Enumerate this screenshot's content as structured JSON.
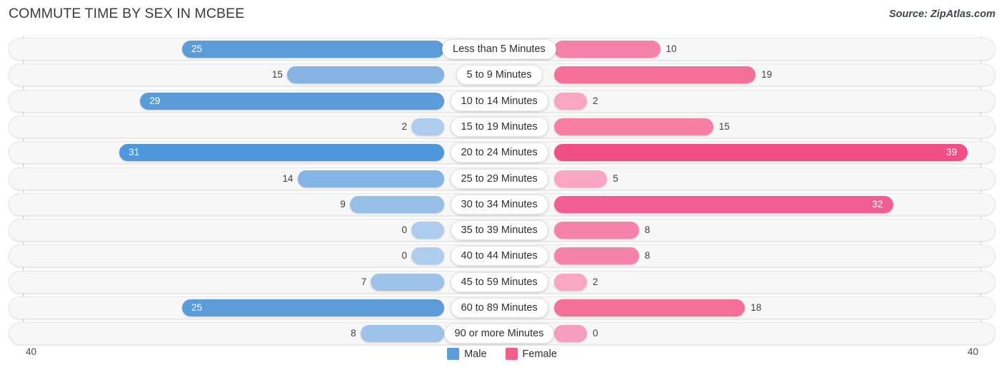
{
  "header": {
    "title": "COMMUTE TIME BY SEX IN MCBEE",
    "source": "Source: ZipAtlas.com"
  },
  "legend": {
    "items": [
      {
        "label": "Male",
        "color": "#5b9bd8"
      },
      {
        "label": "Female",
        "color": "#ef5f8c"
      }
    ]
  },
  "axis": {
    "left_tick": "40",
    "right_tick": "40",
    "max": 40
  },
  "chart_data": {
    "type": "bar",
    "orientation": "horizontal-diverging",
    "title": "COMMUTE TIME BY SEX IN MCBEE",
    "xlabel": "",
    "ylabel": "",
    "xlim": [
      40,
      40
    ],
    "grid": false,
    "legend_position": "bottom-center",
    "categories": [
      "Less than 5 Minutes",
      "5 to 9 Minutes",
      "10 to 14 Minutes",
      "15 to 19 Minutes",
      "20 to 24 Minutes",
      "25 to 29 Minutes",
      "30 to 34 Minutes",
      "35 to 39 Minutes",
      "40 to 44 Minutes",
      "45 to 59 Minutes",
      "60 to 89 Minutes",
      "90 or more Minutes"
    ],
    "series": [
      {
        "name": "Male",
        "values": [
          25,
          15,
          29,
          2,
          31,
          14,
          9,
          0,
          0,
          7,
          25,
          8
        ]
      },
      {
        "name": "Female",
        "values": [
          10,
          19,
          2,
          15,
          39,
          5,
          32,
          8,
          8,
          2,
          18,
          0
        ]
      }
    ]
  },
  "rows": [
    {
      "label": "Less than 5 Minutes",
      "male": "25",
      "female": "10",
      "male_val": 25,
      "female_val": 10,
      "male_color": "#5b9bd8",
      "female_color": "#f581a8",
      "male_inside": true,
      "female_inside": false
    },
    {
      "label": "5 to 9 Minutes",
      "male": "15",
      "female": "19",
      "male_val": 15,
      "female_val": 19,
      "male_color": "#85b4e4",
      "female_color": "#f4709b",
      "male_inside": false,
      "female_inside": false
    },
    {
      "label": "10 to 14 Minutes",
      "male": "29",
      "female": "2",
      "male_val": 29,
      "female_val": 2,
      "male_color": "#5b9bd8",
      "female_color": "#f9a6c2",
      "male_inside": true,
      "female_inside": false
    },
    {
      "label": "15 to 19 Minutes",
      "male": "2",
      "female": "15",
      "male_val": 2,
      "female_val": 15,
      "male_color": "#aecdee",
      "female_color": "#f77fa6",
      "male_inside": false,
      "female_inside": false
    },
    {
      "label": "20 to 24 Minutes",
      "male": "31",
      "female": "39",
      "male_val": 31,
      "female_val": 39,
      "male_color": "#5096db",
      "female_color": "#ef4f84",
      "male_inside": true,
      "female_inside": true
    },
    {
      "label": "25 to 29 Minutes",
      "male": "14",
      "female": "5",
      "male_val": 14,
      "female_val": 5,
      "male_color": "#85b4e4",
      "female_color": "#f9a6c2",
      "male_inside": false,
      "female_inside": false
    },
    {
      "label": "30 to 34 Minutes",
      "male": "9",
      "female": "32",
      "male_val": 9,
      "female_val": 32,
      "male_color": "#97bfe8",
      "female_color": "#f15f92",
      "male_inside": false,
      "female_inside": true
    },
    {
      "label": "35 to 39 Minutes",
      "male": "0",
      "female": "8",
      "male_val": 0,
      "female_val": 8,
      "male_color": "#aecdee",
      "female_color": "#f681a9",
      "male_inside": false,
      "female_inside": false
    },
    {
      "label": "40 to 44 Minutes",
      "male": "0",
      "female": "8",
      "male_val": 0,
      "female_val": 8,
      "male_color": "#aecdee",
      "female_color": "#f681a9",
      "male_inside": false,
      "female_inside": false
    },
    {
      "label": "45 to 59 Minutes",
      "male": "7",
      "female": "2",
      "male_val": 7,
      "female_val": 2,
      "male_color": "#9dc3ea",
      "female_color": "#f9a6c2",
      "male_inside": false,
      "female_inside": false
    },
    {
      "label": "60 to 89 Minutes",
      "male": "25",
      "female": "18",
      "male_val": 25,
      "female_val": 18,
      "male_color": "#5b9bd8",
      "female_color": "#f4709b",
      "male_inside": true,
      "female_inside": false
    },
    {
      "label": "90 or more Minutes",
      "male": "8",
      "female": "0",
      "male_val": 8,
      "female_val": 0,
      "male_color": "#9dc3ea",
      "female_color": "#f59ebe",
      "male_inside": false,
      "female_inside": false
    }
  ]
}
